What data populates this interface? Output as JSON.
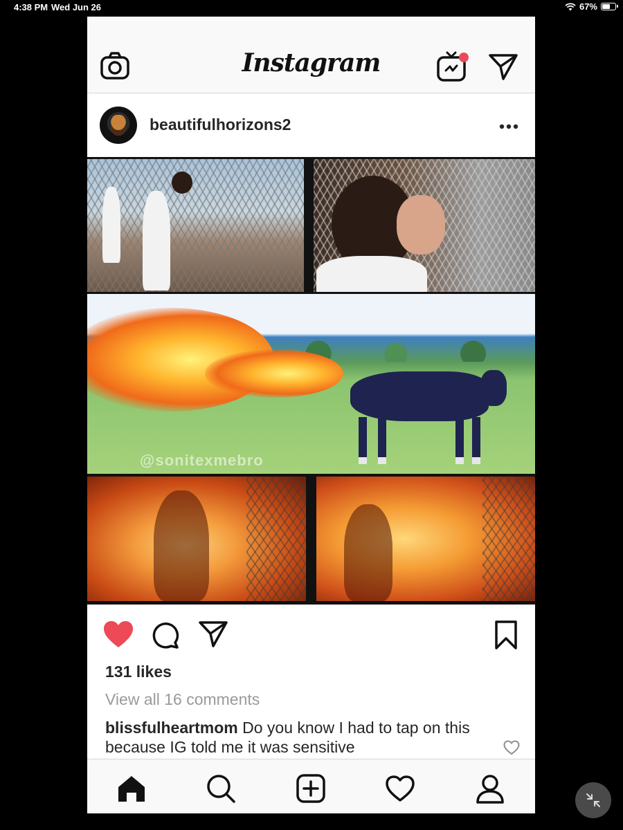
{
  "status_bar": {
    "time": "4:38 PM",
    "date": "Wed Jun 26",
    "battery": "67%",
    "battery_level": 0.67
  },
  "app": {
    "logo": "Instagram",
    "icons": {
      "camera": "camera-icon",
      "igtv": "igtv-icon",
      "direct": "paper-plane-icon"
    },
    "notification_dot_color": "#ed4956"
  },
  "post": {
    "username": "beautifulhorizons2",
    "watermark": "@sonitexmebro",
    "liked": true,
    "like_color": "#ed4956",
    "likes_text": "131 likes",
    "view_comments_text": "View all 16 comments",
    "comment": {
      "username": "blissfulheartmom",
      "text": "Do you know I had to tap on this because IG told me it was sensitive"
    }
  },
  "bottom_nav": {
    "items": [
      "home-icon",
      "search-icon",
      "add-post-icon",
      "activity-heart-icon",
      "profile-icon"
    ]
  }
}
